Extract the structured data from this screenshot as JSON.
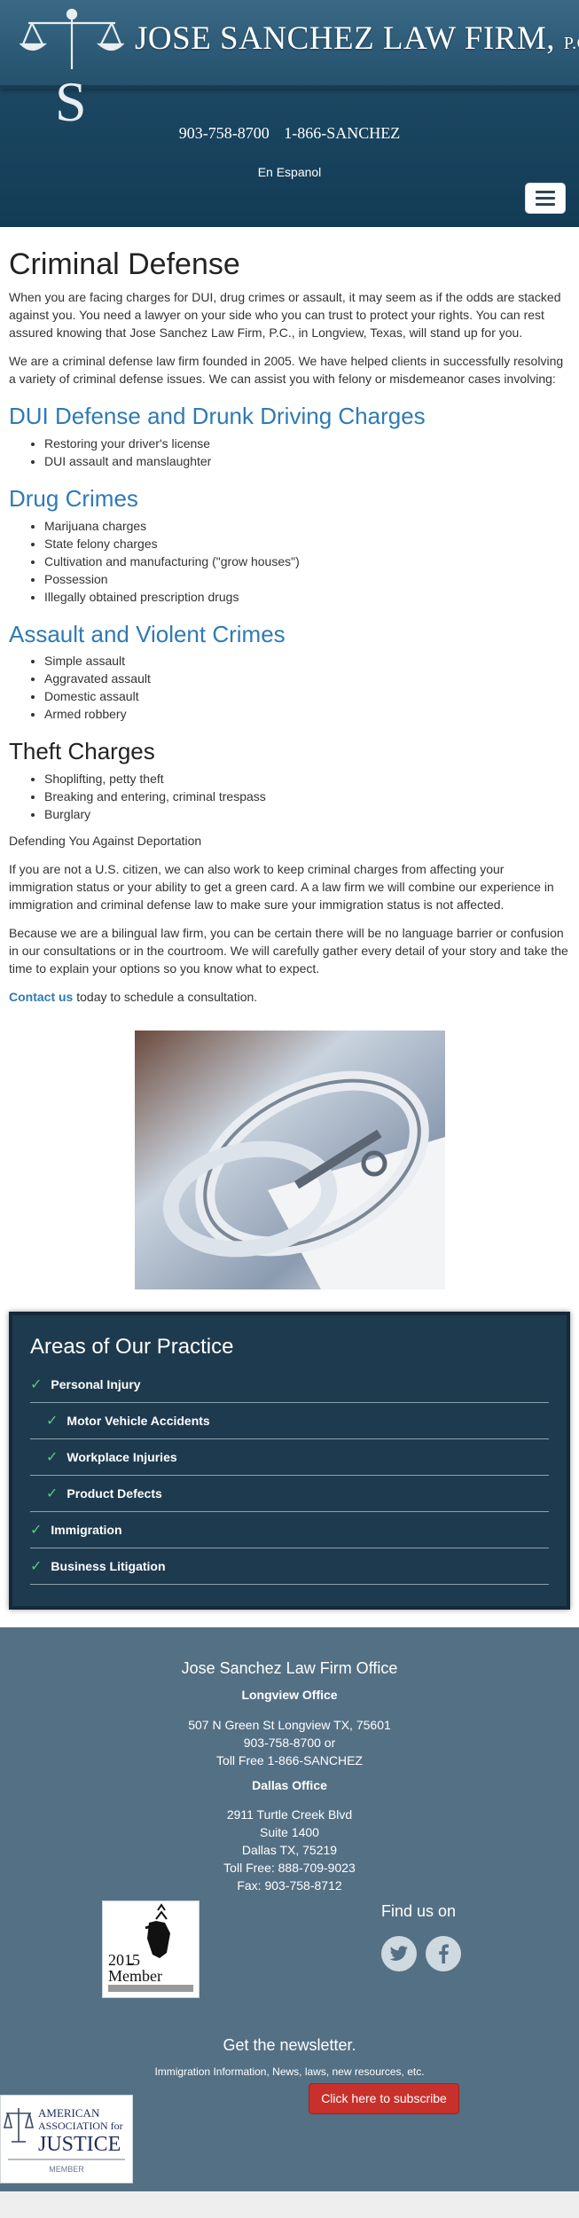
{
  "header": {
    "firm_name": "JOSE SANCHEZ LAW FIRM,",
    "firm_suffix": "P.C.",
    "phone_local": "903-758-8700",
    "phone_toll": "1-866-SANCHEZ",
    "language_link": "En Espanol"
  },
  "main": {
    "title": "Criminal Defense",
    "intro_1": "When you are facing charges for DUI, drug crimes or assault, it may seem as if the odds are stacked against you. You need a lawyer on your side who you can trust to protect your rights. You can rest assured knowing that Jose Sanchez Law Firm, P.C., in Longview, Texas, will stand up for you.",
    "intro_2": "We are a criminal defense law firm founded in 2005. We have helped clients in successfully resolving a variety of criminal defense issues. We can assist you with felony or misdemeanor cases involving:",
    "sections": [
      {
        "heading": "DUI Defense and Drunk Driving Charges",
        "items": [
          "Restoring your driver's license",
          "DUI assault and manslaughter"
        ]
      },
      {
        "heading": "Drug Crimes",
        "items": [
          "Marijuana charges",
          "State felony charges",
          "Cultivation and manufacturing (\"grow houses\")",
          "Possession",
          "Illegally obtained prescription drugs"
        ]
      },
      {
        "heading": "Assault and Violent Crimes",
        "items": [
          "Simple assault",
          "Aggravated assault",
          "Domestic assault",
          "Armed robbery"
        ]
      },
      {
        "heading": "Theft Charges",
        "items": [
          "Shoplifting, petty theft",
          "Breaking and entering, criminal trespass",
          "Burglary"
        ]
      }
    ],
    "deportation_heading": "Defending You Against Deportation",
    "deportation_1": "If you are not a U.S. citizen, we can also work to keep criminal charges from affecting your immigration status or your ability to get a green card. A a law firm we will combine our experience in immigration and criminal defense law to make sure your immigration status is not affected.",
    "deportation_2": "Because we are a bilingual law firm, you can be certain there will be no language barrier or confusion in our consultations or in the courtroom. We will carefully gather every detail of your story and take the time to explain your options so you know what to expect.",
    "contact_link": "Contact us",
    "contact_rest": " today to schedule a consultation."
  },
  "practice": {
    "title": "Areas of Our Practice",
    "items": [
      {
        "label": "Personal Injury",
        "sub": false
      },
      {
        "label": "Motor Vehicle Accidents",
        "sub": true
      },
      {
        "label": "Workplace Injuries",
        "sub": true
      },
      {
        "label": "Product Defects",
        "sub": true
      },
      {
        "label": "Immigration",
        "sub": false
      },
      {
        "label": "Business Litigation",
        "sub": false
      }
    ]
  },
  "footer": {
    "title": "Jose Sanchez Law Firm Office",
    "longview": {
      "label": "Longview Office",
      "address": "507 N Green St Longview TX, 75601",
      "phone": "903-758-8700 or",
      "toll": "Toll Free 1-866-SANCHEZ"
    },
    "dallas": {
      "label": "Dallas Office",
      "street": "2911 Turtle Creek Blvd",
      "suite": "Suite 1400",
      "city": "Dallas TX, 75219",
      "toll": "Toll Free: 888-709-9023",
      "fax": "Fax: 903-758-8712"
    },
    "badge_year": "2015",
    "badge_label": "Member",
    "find_us": "Find us on",
    "newsletter_title": "Get the newsletter.",
    "newsletter_sub": "Immigration Information, News, laws, new resources, etc.",
    "subscribe_label": "Click here to subscribe",
    "aaj_line1": "AMERICAN",
    "aaj_line2": "ASSOCIATION for",
    "aaj_line3": "JUSTICE",
    "aaj_line4": "MEMBER"
  },
  "colors": {
    "header_dark": "#123c56",
    "link_blue": "#2f7ab5",
    "practice_bg": "#1e3a4e",
    "check_green": "#4fd07a",
    "footer_bg": "#547084",
    "subscribe_red": "#c8302b"
  }
}
